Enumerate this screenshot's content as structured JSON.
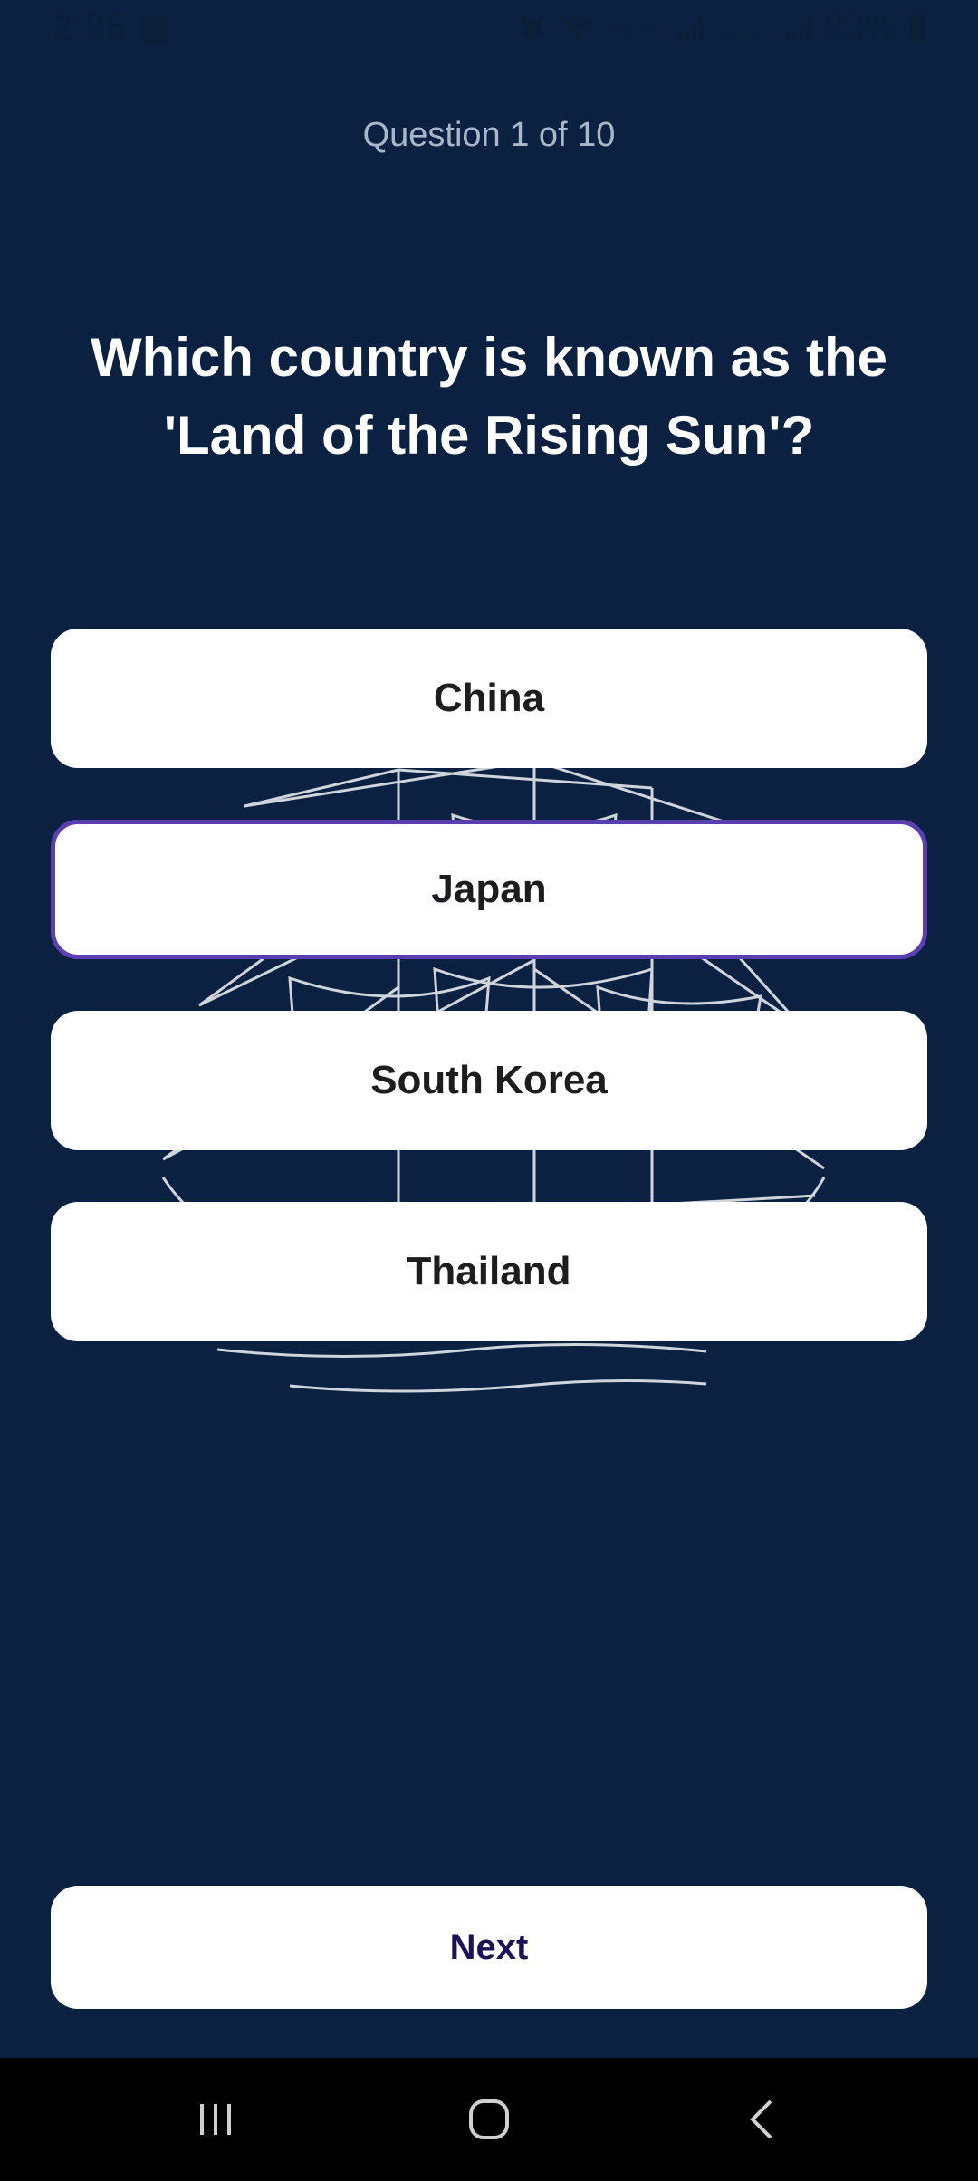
{
  "status_bar": {
    "time": "2:26",
    "network1": "Vo)) LTE1",
    "network2": "Vo)) LTE2",
    "network2_roaming": "R",
    "battery": "83%"
  },
  "quiz": {
    "counter": "Question 1 of 10",
    "question": "Which country is known as the 'Land of the Rising Sun'?",
    "options": [
      {
        "label": "China",
        "selected": false
      },
      {
        "label": "Japan",
        "selected": true
      },
      {
        "label": "South Korea",
        "selected": false
      },
      {
        "label": "Thailand",
        "selected": false
      }
    ],
    "next_label": "Next"
  },
  "colors": {
    "background": "#0a2142",
    "selected_border": "#5b3fb0",
    "next_text": "#1d1157"
  },
  "icons": {
    "status": [
      "gallery-icon",
      "alarm-icon",
      "wifi-icon",
      "signal-icon",
      "battery-icon"
    ],
    "nav": [
      "recents-icon",
      "home-icon",
      "back-icon"
    ],
    "background_art": "sailing-ship-illustration"
  }
}
